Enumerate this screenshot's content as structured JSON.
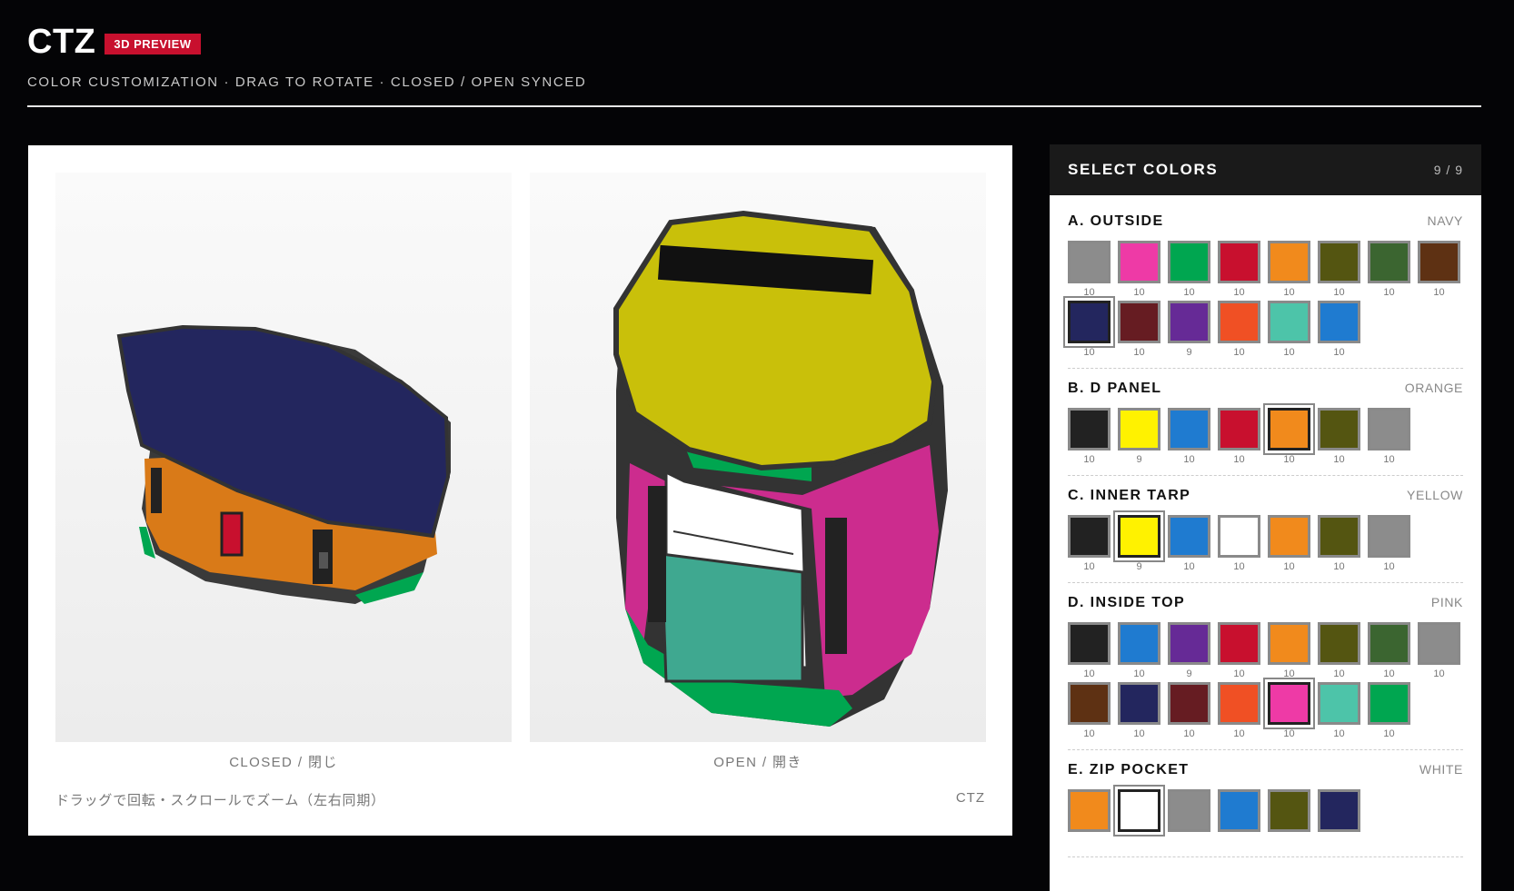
{
  "header": {
    "brand": "CTZ",
    "badge": "3D PREVIEW",
    "subtitle": "COLOR CUSTOMIZATION · DRAG TO ROTATE · CLOSED / OPEN SYNCED"
  },
  "preview": {
    "closed_label": "CLOSED / 閉じ",
    "open_label": "OPEN / 開き",
    "hint": "ドラッグで回転・スクロールでズーム（左右同期）",
    "model_name": "CTZ"
  },
  "panel": {
    "title": "SELECT COLORS",
    "count": "9 / 9",
    "sections": [
      {
        "title": "A. OUTSIDE",
        "value": "NAVY",
        "swatches": [
          {
            "color": "#8c8c8c",
            "stock": "10"
          },
          {
            "color": "#ee3aa6",
            "stock": "10"
          },
          {
            "color": "#00a650",
            "stock": "10"
          },
          {
            "color": "#c8102e",
            "stock": "10"
          },
          {
            "color": "#f18a1c",
            "stock": "10"
          },
          {
            "color": "#545511",
            "stock": "10"
          },
          {
            "color": "#3b6530",
            "stock": "10"
          },
          {
            "color": "#5e3113",
            "stock": "10"
          },
          {
            "color": "#23265e",
            "stock": "10",
            "selected": true
          },
          {
            "color": "#661c22",
            "stock": "10"
          },
          {
            "color": "#662a96",
            "stock": "9"
          },
          {
            "color": "#f05024",
            "stock": "10"
          },
          {
            "color": "#4dc4a9",
            "stock": "10"
          },
          {
            "color": "#1f7bd0",
            "stock": "10"
          }
        ]
      },
      {
        "title": "B. D PANEL",
        "value": "ORANGE",
        "swatches": [
          {
            "color": "#222222",
            "stock": "10"
          },
          {
            "color": "#fff200",
            "stock": "9"
          },
          {
            "color": "#1f7bd0",
            "stock": "10"
          },
          {
            "color": "#c8102e",
            "stock": "10"
          },
          {
            "color": "#f18a1c",
            "stock": "10",
            "selected": true
          },
          {
            "color": "#545511",
            "stock": "10"
          },
          {
            "color": "#8c8c8c",
            "stock": "10"
          }
        ]
      },
      {
        "title": "C. INNER TARP",
        "value": "YELLOW",
        "swatches": [
          {
            "color": "#222222",
            "stock": "10"
          },
          {
            "color": "#fff200",
            "stock": "9",
            "selected": true
          },
          {
            "color": "#1f7bd0",
            "stock": "10"
          },
          {
            "color": "#ffffff",
            "stock": "10"
          },
          {
            "color": "#f18a1c",
            "stock": "10"
          },
          {
            "color": "#545511",
            "stock": "10"
          },
          {
            "color": "#8c8c8c",
            "stock": "10"
          }
        ]
      },
      {
        "title": "D. INSIDE TOP",
        "value": "PINK",
        "swatches": [
          {
            "color": "#222222",
            "stock": "10"
          },
          {
            "color": "#1f7bd0",
            "stock": "10"
          },
          {
            "color": "#662a96",
            "stock": "9"
          },
          {
            "color": "#c8102e",
            "stock": "10"
          },
          {
            "color": "#f18a1c",
            "stock": "10"
          },
          {
            "color": "#545511",
            "stock": "10"
          },
          {
            "color": "#3b6530",
            "stock": "10"
          },
          {
            "color": "#8c8c8c",
            "stock": "10"
          },
          {
            "color": "#5e3113",
            "stock": "10"
          },
          {
            "color": "#23265e",
            "stock": "10"
          },
          {
            "color": "#661c22",
            "stock": "10"
          },
          {
            "color": "#f05024",
            "stock": "10"
          },
          {
            "color": "#ee3aa6",
            "stock": "10",
            "selected": true
          },
          {
            "color": "#4dc4a9",
            "stock": "10"
          },
          {
            "color": "#00a650",
            "stock": "10"
          }
        ]
      },
      {
        "title": "E. ZIP POCKET",
        "value": "WHITE",
        "swatches": [
          {
            "color": "#f18a1c",
            "stock": ""
          },
          {
            "color": "#ffffff",
            "stock": "",
            "selected": true
          },
          {
            "color": "#8c8c8c",
            "stock": ""
          },
          {
            "color": "#1f7bd0",
            "stock": ""
          },
          {
            "color": "#545511",
            "stock": ""
          },
          {
            "color": "#23265e",
            "stock": ""
          }
        ]
      }
    ]
  }
}
